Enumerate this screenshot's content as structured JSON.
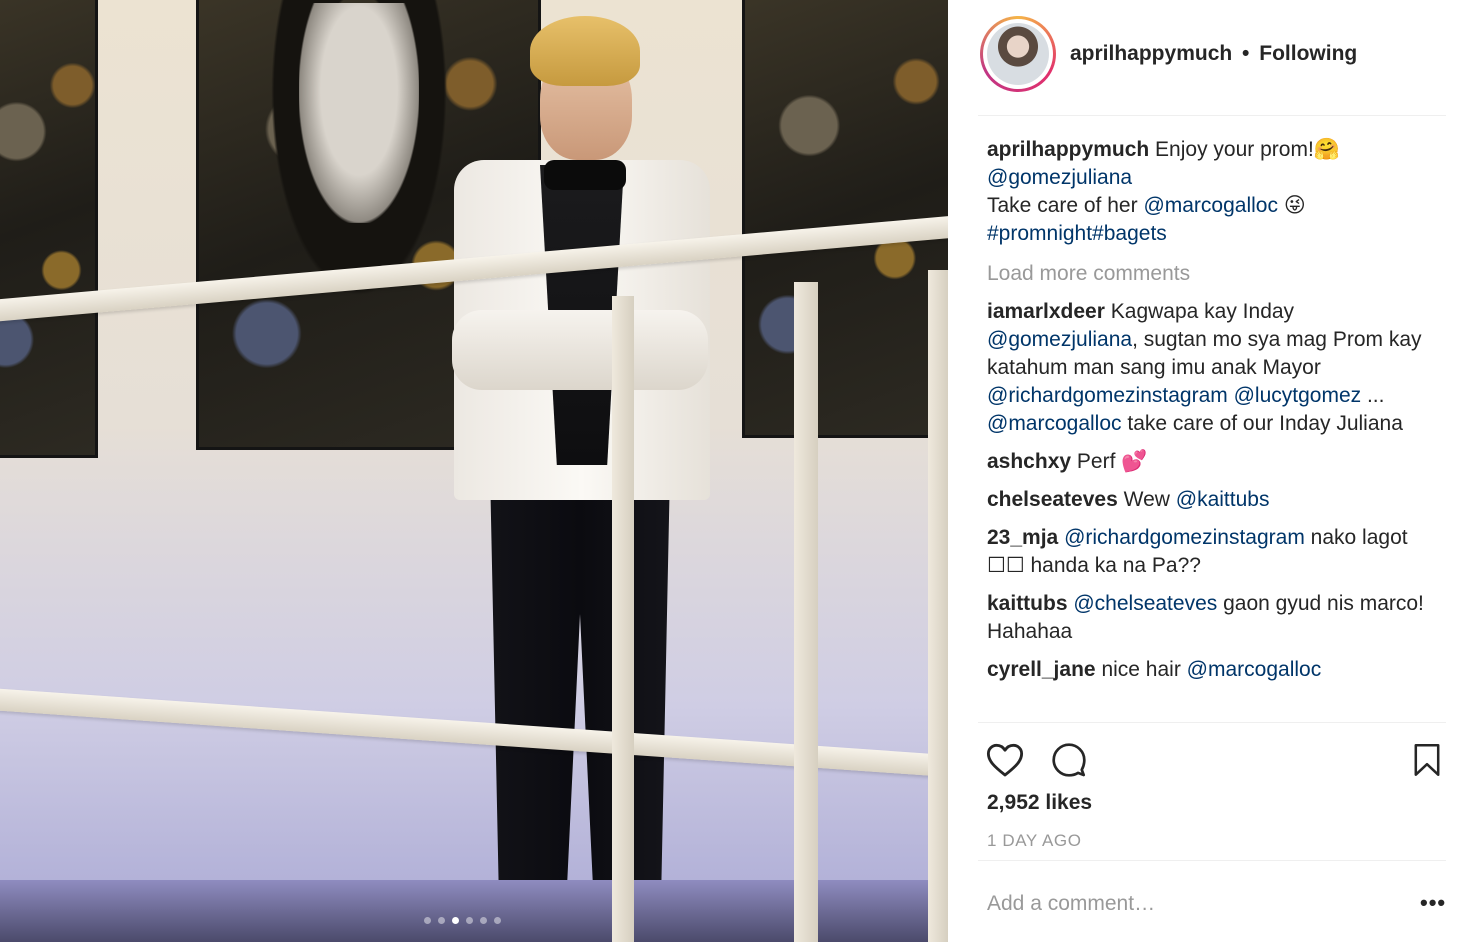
{
  "post": {
    "owner_username": "aprilhappymuch",
    "separator": "•",
    "follow_status": "Following",
    "carousel_total": 6,
    "carousel_active": 3
  },
  "caption": {
    "username": "aprilhappymuch",
    "text_1": "Enjoy your prom!🤗",
    "mention_1": "@gomezjuliana",
    "text_2": "Take care of her",
    "mention_2": "@marcogalloc",
    "emoji_2": "😜",
    "hashtags": "#promnight#bagets"
  },
  "load_more": "Load more comments",
  "comments": [
    {
      "username": "iamarlxdeer",
      "t1": "Kagwapa kay Inday",
      "m1": "@gomezjuliana",
      "t2": ", sugtan mo sya mag Prom kay katahum man sang imu anak Mayor",
      "m2": "@richardgomezinstagram",
      "m3": "@lucytgomez",
      "t3": "...",
      "m4": "@marcogalloc",
      "t4": "take care of our Inday Juliana"
    },
    {
      "username": "ashchxy",
      "text": "Perf 💕"
    },
    {
      "username": "chelseateves",
      "text": "Wew",
      "mention": "@kaittubs"
    },
    {
      "username": "23_mja",
      "mention": "@richardgomezinstagram",
      "text": "nako lagot ☐☐ handa ka na Pa??"
    },
    {
      "username": "kaittubs",
      "mention": "@chelseateves",
      "text": "gaon gyud nis marco! Hahahaa"
    },
    {
      "username": "cyrell_jane",
      "text": "nice hair",
      "mention": "@marcogalloc"
    }
  ],
  "stats": {
    "likes": "2,952 likes",
    "time_ago": "1 DAY AGO"
  },
  "comment_box": {
    "placeholder": "Add a comment…",
    "more_label": "•••"
  },
  "icons": {
    "like": "heart-icon",
    "comment": "comment-bubble-icon",
    "save": "bookmark-icon"
  }
}
